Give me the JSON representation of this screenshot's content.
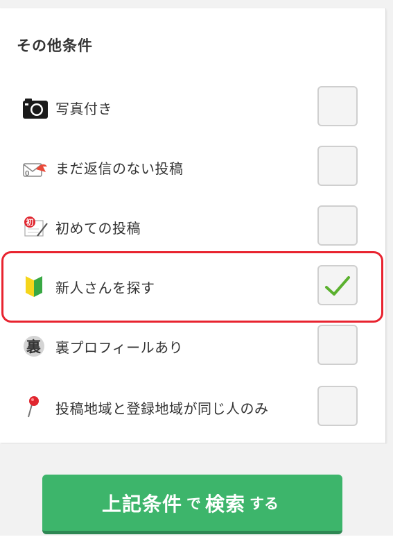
{
  "section": {
    "title": "その他条件"
  },
  "conditions": [
    {
      "label": "写真付き",
      "icon": "camera-icon",
      "checked": false
    },
    {
      "label": "まだ返信のない投稿",
      "icon": "no-reply-mail-icon",
      "checked": false
    },
    {
      "label": "初めての投稿",
      "icon": "first-post-icon",
      "checked": false
    },
    {
      "label": "新人さんを探す",
      "icon": "beginner-mark-icon",
      "checked": true
    },
    {
      "label": "裏プロフィールあり",
      "icon": "ura-badge-icon",
      "checked": false
    },
    {
      "label": "投稿地域と登録地域が同じ人のみ",
      "icon": "map-pin-icon",
      "checked": false
    }
  ],
  "icon_text": {
    "ura": "裏",
    "first": "初"
  },
  "search_button": {
    "part1": "上記条件",
    "part2": "で",
    "part3": "検索",
    "part4": "する"
  },
  "colors": {
    "accent_green": "#3db56b",
    "check_green": "#5bb12f",
    "highlight_red": "#e8232f"
  }
}
